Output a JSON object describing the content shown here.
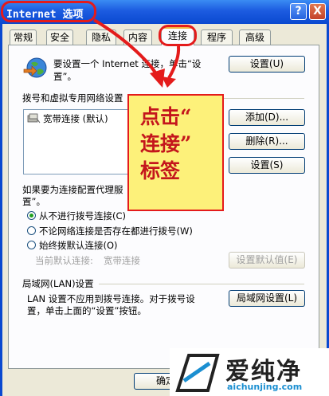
{
  "window": {
    "title": "Internet 选项",
    "help_label": "?",
    "close_label": "X"
  },
  "tabs": [
    {
      "label": "常规"
    },
    {
      "label": "安全"
    },
    {
      "label": "隐私"
    },
    {
      "label": "内容"
    },
    {
      "label": "连接",
      "active": true
    },
    {
      "label": "程序"
    },
    {
      "label": "高级"
    }
  ],
  "setup": {
    "line1": "要设置一个 Internet 连接，单击“设",
    "line2": "置”。",
    "button": "设置(U)"
  },
  "dialup": {
    "heading": "拨号和虚拟专用网络设置",
    "items": [
      {
        "label": "宽带连接 (默认)"
      }
    ],
    "add_button": "添加(D)...",
    "remove_button": "删除(R)...",
    "settings_button": "设置(S)"
  },
  "proxy": {
    "line1": "如果要为连接配置代理服",
    "line2": "置”。",
    "options": [
      {
        "label": "从不进行拨号连接(C)",
        "selected": true
      },
      {
        "label": "不论网络连接是否存在都进行拨号(W)",
        "selected": false
      },
      {
        "label": "始终拨默认连接(O)",
        "selected": false
      }
    ],
    "current_default_label": "当前默认连接:",
    "current_default_value": "宽带连接",
    "set_default_button": "设置默认值(E)"
  },
  "lan": {
    "heading": "局域网(LAN)设置",
    "line1": "LAN 设置不应用到拨号连接。对于拨号设",
    "line2": "置，单击上面的“设置”按钮。",
    "button": "局域网设置(L)"
  },
  "footer": {
    "ok_button": "确定"
  },
  "annotation": {
    "lines": [
      "点击“",
      "连接”",
      "标签"
    ],
    "color": "#c4161c",
    "background": "#fdf17a",
    "border": "#e41b1b"
  },
  "watermark": {
    "brand": "爱纯净",
    "url": "aichunjing.com"
  }
}
